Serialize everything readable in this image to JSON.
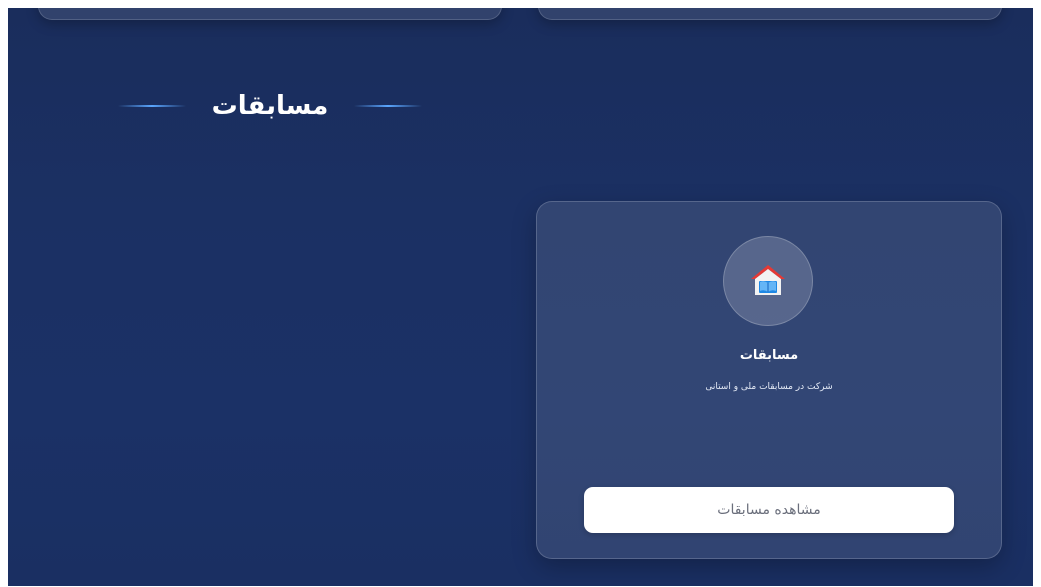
{
  "section": {
    "title": "مسابقات"
  },
  "card": {
    "icon": "school-house-icon",
    "title": "مسابقات",
    "description": "شرکت در مسابقات ملی و استانی",
    "button_label": "مشاهده مسابقات"
  },
  "colors": {
    "background": "#1b3063",
    "accent_line": "#5aa6ff",
    "button_bg": "#ffffff",
    "button_text": "#6b6f7c"
  }
}
